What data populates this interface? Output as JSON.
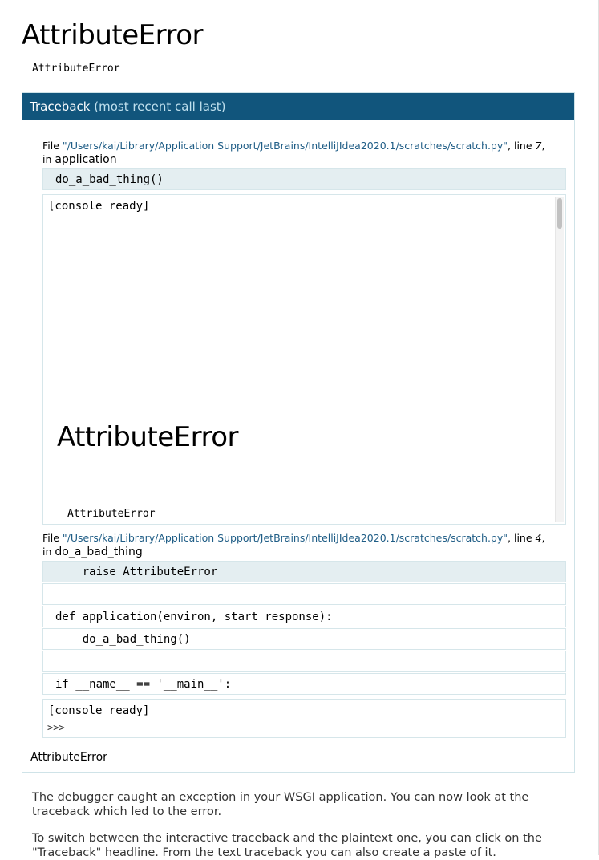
{
  "page": {
    "title": "AttributeError",
    "subtitle": "AttributeError"
  },
  "traceback": {
    "header_main": "Traceback",
    "header_sub": "(most recent call last)",
    "frames": [
      {
        "file_prefix": "File ",
        "path": "\"/Users/kai/Library/Application Support/JetBrains/IntelliJIdea2020.1/scratches/scratch.py\"",
        "line_prefix": ", line ",
        "line_no": "7",
        "in_prefix": "in ",
        "function": "application",
        "current_code": "do_a_bad_thing()",
        "console": {
          "ready": "[console ready]",
          "embedded_title": "AttributeError",
          "embedded_sub": "AttributeError"
        }
      },
      {
        "file_prefix": "File ",
        "path": "\"/Users/kai/Library/Application Support/JetBrains/IntelliJIdea2020.1/scratches/scratch.py\"",
        "line_prefix": ", line ",
        "line_no": "4",
        "in_prefix": "in ",
        "function": "do_a_bad_thing",
        "source_lines": [
          "    raise AttributeError",
          "",
          "def application(environ, start_response):",
          "    do_a_bad_thing()",
          "",
          "if __name__ == '__main__':"
        ],
        "console": {
          "ready": "[console ready]",
          "prompt": ">>>"
        }
      }
    ],
    "exception": "AttributeError"
  },
  "explanation": {
    "p1": "The debugger caught an exception in your WSGI application. You can now look at the traceback which led to the error.",
    "p2": "To switch between the interactive traceback and the plaintext one, you can click on the \"Traceback\" headline. From the text traceback you can also create a paste of it."
  }
}
